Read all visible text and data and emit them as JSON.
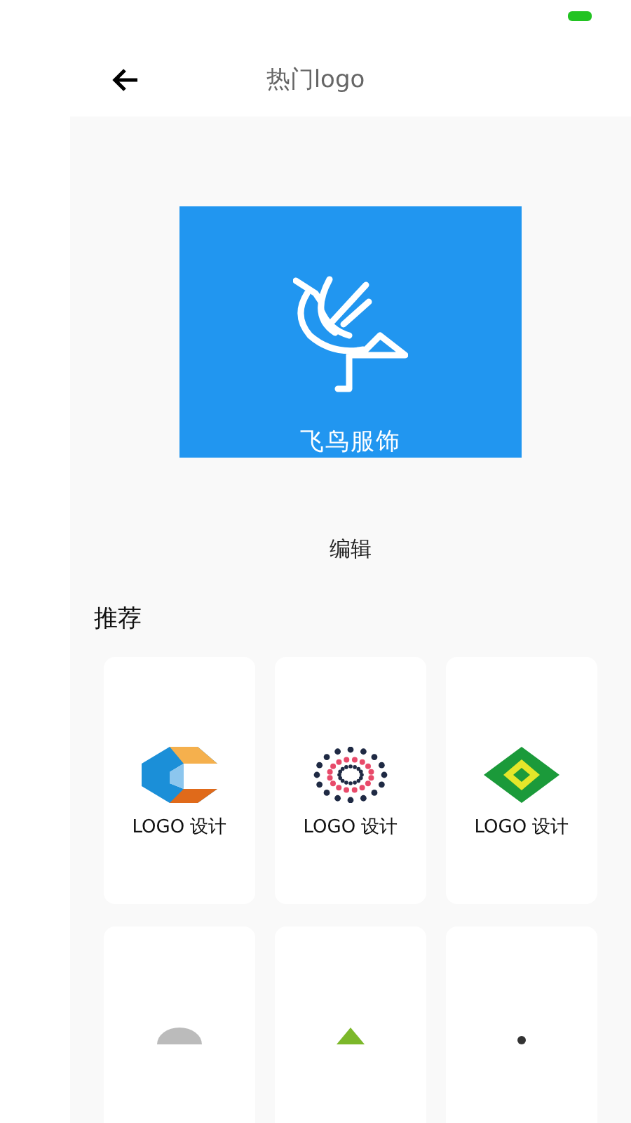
{
  "header": {
    "title": "热门logo"
  },
  "preview": {
    "brand": "飞鸟服饰",
    "action": "编辑"
  },
  "section": {
    "title": "推荐"
  },
  "cards": [
    {
      "kind": "cube",
      "caption": "LOGO 设计"
    },
    {
      "kind": "flower",
      "caption": "LOGO 设计"
    },
    {
      "kind": "diamond",
      "caption": "LOGO 设计"
    },
    {
      "kind": "cap"
    },
    {
      "kind": "leaf"
    },
    {
      "kind": "figure"
    }
  ]
}
